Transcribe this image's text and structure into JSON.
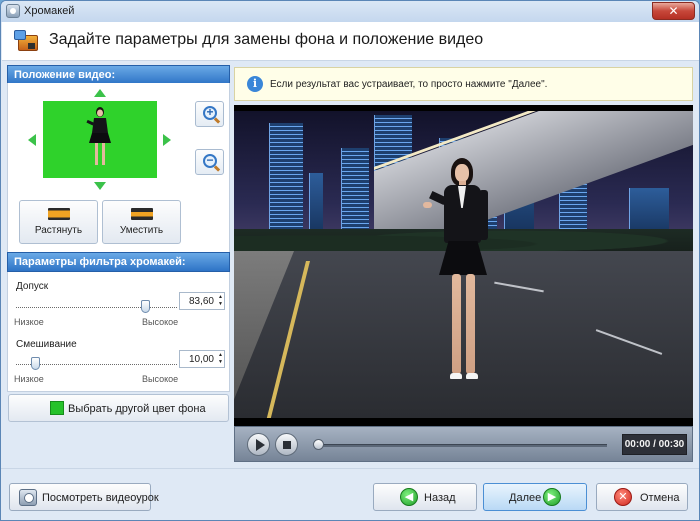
{
  "window": {
    "title": "Хромакей",
    "close_glyph": "✕"
  },
  "header": {
    "title": "Задайте параметры для замены фона и положение видео"
  },
  "position_panel": {
    "heading": "Положение видео:",
    "stretch_label": "Растянуть",
    "fit_label": "Уместить"
  },
  "filter_panel": {
    "heading": "Параметры фильтра хромакей:",
    "tolerance": {
      "label": "Допуск",
      "value": "83,60",
      "level": 0.82,
      "min_label": "Низкое",
      "max_label": "Высокое"
    },
    "blend": {
      "label": "Смешивание",
      "value": "10,00",
      "level": 0.1,
      "min_label": "Низкое",
      "max_label": "Высокое"
    },
    "color_button_label": "Выбрать другой цвет фона",
    "color_swatch": "#26c22a"
  },
  "info": {
    "icon_glyph": "i",
    "text": "Если результат вас устраивает, то просто нажмите \"Далее\"."
  },
  "player": {
    "timecode": "00:00 / 00:30",
    "progress": 0
  },
  "footer": {
    "tutorial_label": "Посмотреть видеоурок",
    "back_label": "Назад",
    "back_glyph": "◀",
    "next_label": "Далее",
    "next_glyph": "▶",
    "cancel_label": "Отмена",
    "cancel_glyph": "✕"
  },
  "colors": {
    "accent": "#2e73c6",
    "chroma_green": "#2fd22b"
  }
}
